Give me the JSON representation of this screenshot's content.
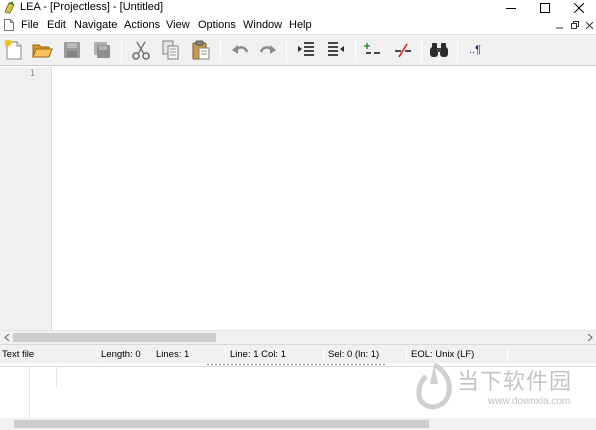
{
  "window": {
    "title": "LEA - [Projectless] - [Untitled]",
    "controls": [
      "minimize",
      "maximize",
      "close"
    ]
  },
  "menu": {
    "items": [
      "File",
      "Edit",
      "Navigate",
      "Actions",
      "View",
      "Options",
      "Window",
      "Help"
    ],
    "mdi_controls": [
      "minimize",
      "restore",
      "close"
    ]
  },
  "toolbar": {
    "buttons": [
      "new-file",
      "open-folder",
      "save",
      "save-all",
      "cut",
      "copy",
      "paste",
      "undo",
      "redo",
      "indent",
      "unindent",
      "comment-line",
      "uncomment-line",
      "find",
      "show-whitespace"
    ],
    "whitespace_label": "..¶"
  },
  "editor": {
    "line_numbers": [
      "1"
    ],
    "content": ""
  },
  "status": {
    "file_type": "Text file",
    "length": "Length: 0",
    "lines": "Lines: 1",
    "position": "Line: 1 Col: 1",
    "selection": "Sel: 0 (ln: 1)",
    "eol": "EOL: Unix (LF)"
  },
  "watermark": {
    "text": "当下软件园",
    "url": "www.downxia.com"
  },
  "colors": {
    "chrome": "#f0f0f0",
    "background": "#ffffff",
    "scrollbar_thumb": "#cdcdcd",
    "folder": "#e8a93c",
    "red_x": "#d42020",
    "green_plus": "#2a9a2a"
  }
}
